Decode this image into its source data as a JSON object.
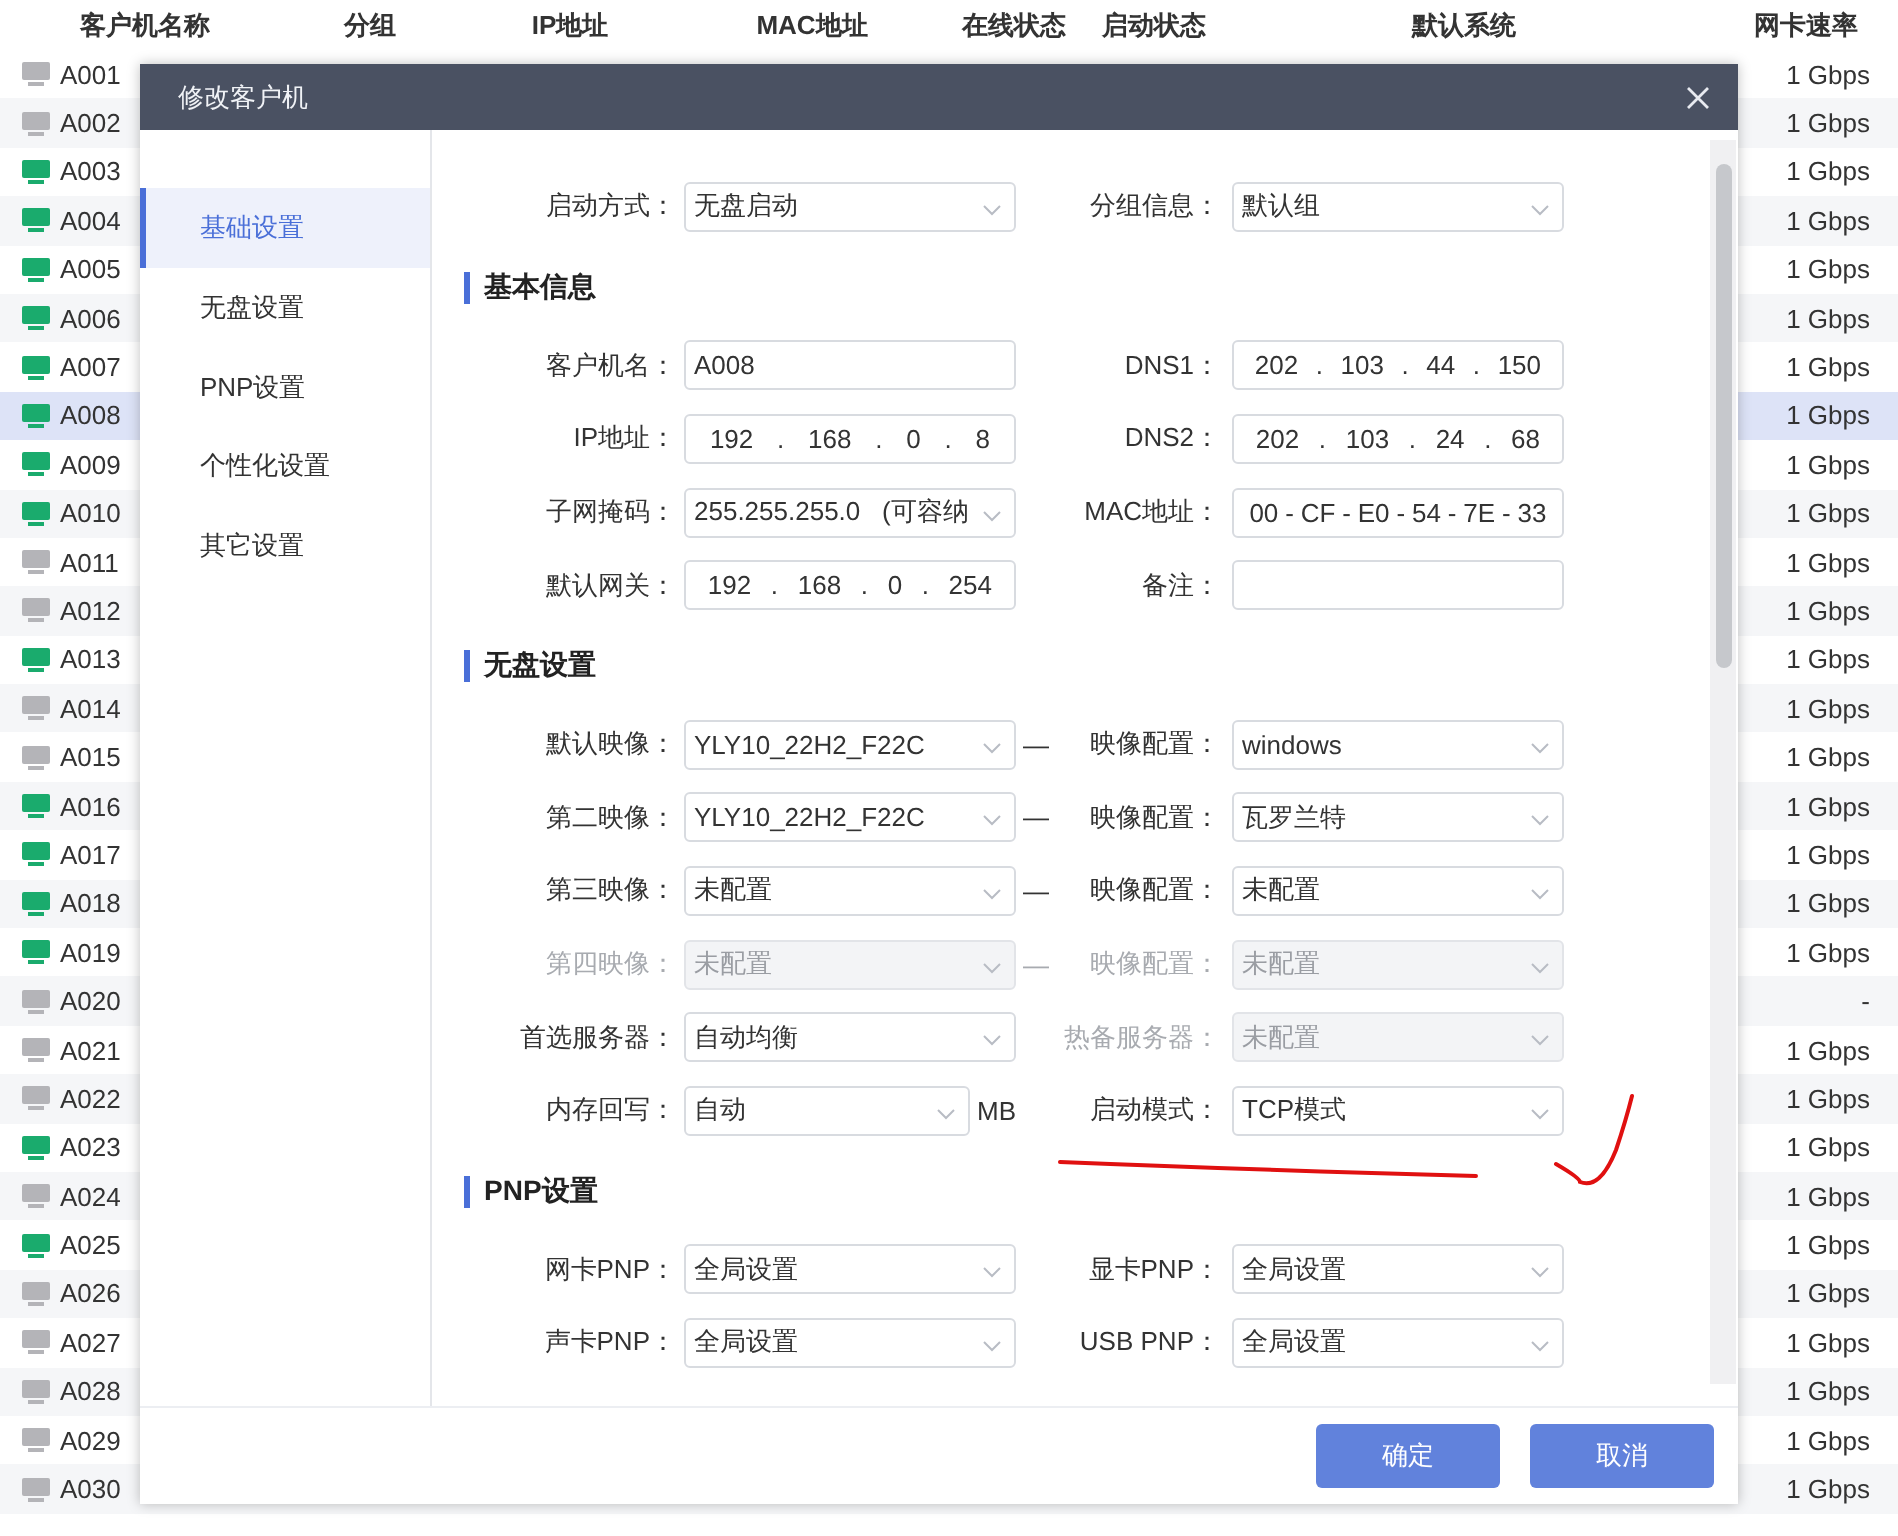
{
  "table": {
    "columns": [
      "客户机名称",
      "分组",
      "IP地址",
      "MAC地址",
      "在线状态",
      "启动状态",
      "默认系统",
      "网卡速率"
    ],
    "rows": [
      {
        "name": "A001",
        "online": false,
        "selected": false,
        "speed": "1 Gbps"
      },
      {
        "name": "A002",
        "online": false,
        "selected": false,
        "speed": "1 Gbps"
      },
      {
        "name": "A003",
        "online": true,
        "selected": false,
        "speed": "1 Gbps"
      },
      {
        "name": "A004",
        "online": true,
        "selected": false,
        "speed": "1 Gbps"
      },
      {
        "name": "A005",
        "online": true,
        "selected": false,
        "speed": "1 Gbps"
      },
      {
        "name": "A006",
        "online": true,
        "selected": false,
        "speed": "1 Gbps"
      },
      {
        "name": "A007",
        "online": true,
        "selected": false,
        "speed": "1 Gbps"
      },
      {
        "name": "A008",
        "online": true,
        "selected": true,
        "speed": "1 Gbps"
      },
      {
        "name": "A009",
        "online": true,
        "selected": false,
        "speed": "1 Gbps"
      },
      {
        "name": "A010",
        "online": true,
        "selected": false,
        "speed": "1 Gbps"
      },
      {
        "name": "A011",
        "online": false,
        "selected": false,
        "speed": "1 Gbps"
      },
      {
        "name": "A012",
        "online": false,
        "selected": false,
        "speed": "1 Gbps"
      },
      {
        "name": "A013",
        "online": true,
        "selected": false,
        "speed": "1 Gbps"
      },
      {
        "name": "A014",
        "online": false,
        "selected": false,
        "speed": "1 Gbps"
      },
      {
        "name": "A015",
        "online": false,
        "selected": false,
        "speed": "1 Gbps"
      },
      {
        "name": "A016",
        "online": true,
        "selected": false,
        "speed": "1 Gbps"
      },
      {
        "name": "A017",
        "online": true,
        "selected": false,
        "speed": "1 Gbps"
      },
      {
        "name": "A018",
        "online": true,
        "selected": false,
        "speed": "1 Gbps"
      },
      {
        "name": "A019",
        "online": true,
        "selected": false,
        "speed": "1 Gbps"
      },
      {
        "name": "A020",
        "online": false,
        "selected": false,
        "speed": "-"
      },
      {
        "name": "A021",
        "online": false,
        "selected": false,
        "speed": "1 Gbps"
      },
      {
        "name": "A022",
        "online": false,
        "selected": false,
        "speed": "1 Gbps"
      },
      {
        "name": "A023",
        "online": true,
        "selected": false,
        "speed": "1 Gbps"
      },
      {
        "name": "A024",
        "online": false,
        "selected": false,
        "speed": "1 Gbps"
      },
      {
        "name": "A025",
        "online": true,
        "selected": false,
        "speed": "1 Gbps"
      },
      {
        "name": "A026",
        "online": false,
        "selected": false,
        "speed": "1 Gbps"
      },
      {
        "name": "A027",
        "online": false,
        "selected": false,
        "speed": "1 Gbps"
      },
      {
        "name": "A028",
        "online": false,
        "selected": false,
        "speed": "1 Gbps"
      },
      {
        "name": "A029",
        "online": false,
        "selected": false,
        "speed": "1 Gbps"
      },
      {
        "name": "A030",
        "online": false,
        "selected": false,
        "speed": "1 Gbps"
      }
    ]
  },
  "dialog": {
    "title": "修改客户机",
    "nav": [
      {
        "label": "基础设置",
        "selected": true
      },
      {
        "label": "无盘设置",
        "selected": false
      },
      {
        "label": "PNP设置",
        "selected": false
      },
      {
        "label": "个性化设置",
        "selected": false
      },
      {
        "label": "其它设置",
        "selected": false
      }
    ],
    "sections": [
      {
        "rows": [
          {
            "left": {
              "label": "启动方式：",
              "kind": "select",
              "value": "无盘启动",
              "disabled": false
            },
            "right": {
              "label": "分组信息：",
              "kind": "select",
              "value": "默认组",
              "disabled": false
            }
          }
        ]
      },
      {
        "title": "基本信息",
        "rows": [
          {
            "left": {
              "label": "客户机名：",
              "kind": "text",
              "value": "A008",
              "disabled": false
            },
            "right": {
              "label": "DNS1：",
              "kind": "ip",
              "segments": [
                "202",
                "103",
                "44",
                "150"
              ],
              "separator": ".",
              "disabled": false
            }
          },
          {
            "left": {
              "label": "IP地址：",
              "kind": "ip",
              "segments": [
                "192",
                "168",
                "0",
                "8"
              ],
              "separator": ".",
              "disabled": false
            },
            "right": {
              "label": "DNS2：",
              "kind": "ip",
              "segments": [
                "202",
                "103",
                "24",
                "68"
              ],
              "separator": ".",
              "disabled": false
            }
          },
          {
            "left": {
              "label": "子网掩码：",
              "kind": "select",
              "value": "255.255.255.0   (可容纳",
              "disabled": false
            },
            "right": {
              "label": "MAC地址：",
              "kind": "ip",
              "segments": [
                "00",
                "CF",
                "E0",
                "54",
                "7E",
                "33"
              ],
              "separator": "-",
              "disabled": false
            }
          },
          {
            "left": {
              "label": "默认网关：",
              "kind": "ip",
              "segments": [
                "192",
                "168",
                "0",
                "254"
              ],
              "separator": ".",
              "disabled": false
            },
            "right": {
              "label": "备注：",
              "kind": "text",
              "disabled": false
            }
          }
        ]
      },
      {
        "title": "无盘设置",
        "rows": [
          {
            "left": {
              "label": "默认映像：",
              "kind": "select",
              "value": "YLY10_22H2_F22C",
              "disabled": false
            },
            "connector": "—",
            "right": {
              "label": "映像配置：",
              "kind": "select",
              "value": "windows",
              "disabled": false
            }
          },
          {
            "left": {
              "label": "第二映像：",
              "kind": "select",
              "value": "YLY10_22H2_F22C",
              "disabled": false
            },
            "connector": "—",
            "right": {
              "label": "映像配置：",
              "kind": "select",
              "value": "瓦罗兰特",
              "disabled": false
            }
          },
          {
            "left": {
              "label": "第三映像：",
              "kind": "select",
              "value": "未配置",
              "disabled": false
            },
            "connector": "—",
            "right": {
              "label": "映像配置：",
              "kind": "select",
              "value": "未配置",
              "disabled": false
            }
          },
          {
            "left": {
              "label": "第四映像：",
              "kind": "select",
              "value": "未配置",
              "disabled": true
            },
            "connector": "—",
            "right": {
              "label": "映像配置：",
              "kind": "select",
              "value": "未配置",
              "disabled": true
            }
          },
          {
            "left": {
              "label": "首选服务器：",
              "kind": "select",
              "value": "自动均衡",
              "disabled": false
            },
            "right": {
              "label": "热备服务器：",
              "kind": "select",
              "value": "未配置",
              "disabled": true
            }
          },
          {
            "left": {
              "label": "内存回写：",
              "kind": "select",
              "value": "自动",
              "disabled": false,
              "suffix": "MB"
            },
            "right": {
              "label": "启动模式：",
              "kind": "select",
              "value": "TCP模式",
              "disabled": false
            }
          }
        ]
      },
      {
        "title": "PNP设置",
        "rows": [
          {
            "left": {
              "label": "网卡PNP：",
              "kind": "select",
              "value": "全局设置",
              "disabled": false
            },
            "right": {
              "label": "显卡PNP：",
              "kind": "select",
              "value": "全局设置",
              "disabled": false
            }
          },
          {
            "left": {
              "label": "声卡PNP：",
              "kind": "select",
              "value": "全局设置",
              "disabled": false
            },
            "right": {
              "label": "USB PNP：",
              "kind": "select",
              "value": "全局设置",
              "disabled": false
            }
          }
        ]
      }
    ],
    "buttons": [
      "确定",
      "取消"
    ]
  }
}
